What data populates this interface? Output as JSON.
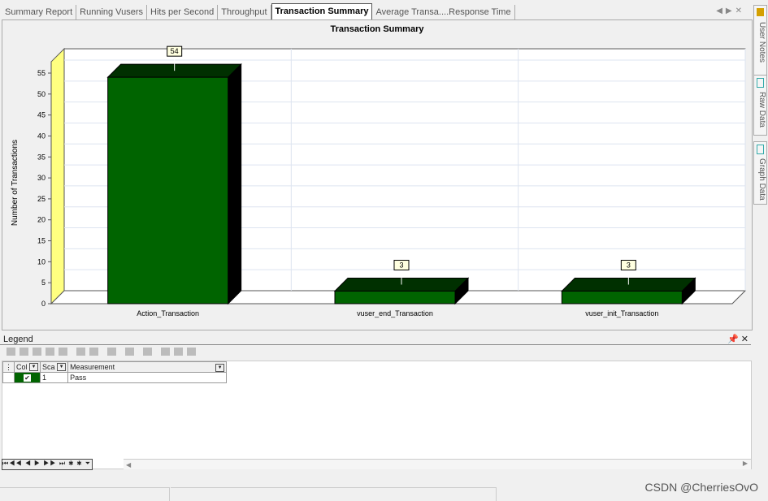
{
  "tabs": [
    "Summary Report",
    "Running Vusers",
    "Hits per Second",
    "Throughput",
    "Transaction Summary",
    "Average Transa....Response Time"
  ],
  "active_tab": 4,
  "side_tabs": [
    "User Notes",
    "Raw Data",
    "Graph Data"
  ],
  "chart_data": {
    "type": "bar",
    "title": "Transaction Summary",
    "ylabel": "Number of Transactions",
    "xlabel": "",
    "categories": [
      "Action_Transaction",
      "vuser_end_Transaction",
      "vuser_init_Transaction"
    ],
    "values": [
      54,
      3,
      3
    ],
    "ylim": [
      0,
      55
    ],
    "yticks": [
      0,
      5,
      10,
      15,
      20,
      25,
      30,
      35,
      40,
      45,
      50,
      55
    ],
    "grid": true,
    "style": "3d",
    "bar_color": "#006400"
  },
  "legend": {
    "title": "Legend",
    "columns": [
      "Col",
      "Sca",
      "Measurement"
    ],
    "rows": [
      {
        "color": "#006400",
        "checked": true,
        "scale": "1",
        "measurement": "Pass"
      }
    ]
  },
  "watermark": "CSDN @CherriesOvO"
}
